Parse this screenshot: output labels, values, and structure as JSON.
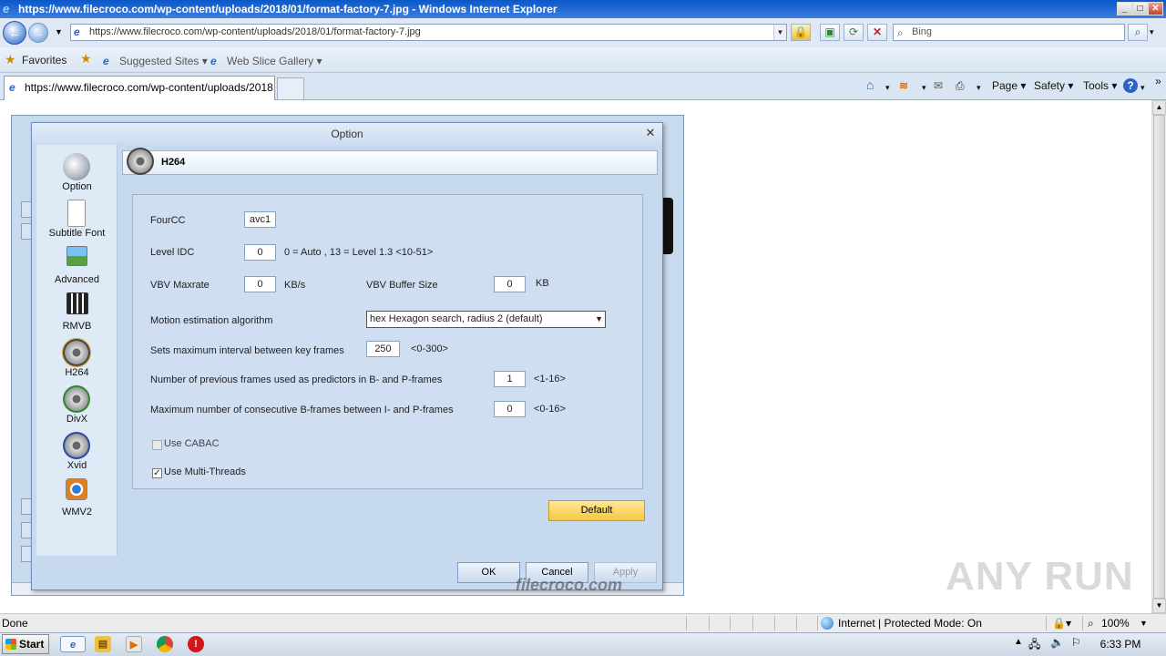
{
  "browser": {
    "window_title": "https://www.filecroco.com/wp-content/uploads/2018/01/format-factory-7.jpg - Windows Internet Explorer",
    "address_url": "https://www.filecroco.com/wp-content/uploads/2018/01/format-factory-7.jpg",
    "search_placeholder": "Bing",
    "favorites_label": "Favorites",
    "suggested_sites": "Suggested Sites",
    "web_slice_gallery": "Web Slice Gallery",
    "tab_title": "https://www.filecroco.com/wp-content/uploads/2018...",
    "commands": {
      "page": "Page",
      "safety": "Safety",
      "tools": "Tools"
    },
    "status_text": "Done",
    "zone_text": "Internet | Protected Mode: On",
    "zoom": "100%"
  },
  "dialog": {
    "title": "Option",
    "section_title": "H264",
    "nav_items": [
      {
        "label": "Option"
      },
      {
        "label": "Subtitle Font"
      },
      {
        "label": "Advanced"
      },
      {
        "label": "RMVB"
      },
      {
        "label": "H264"
      },
      {
        "label": "DivX"
      },
      {
        "label": "Xvid"
      },
      {
        "label": "WMV2"
      }
    ],
    "selected_nav": "H264",
    "fields": {
      "fourcc_label": "FourCC",
      "fourcc_value": "avc1",
      "level_idc_label": "Level IDC",
      "level_idc_value": "0",
      "level_idc_hint": "0 = Auto , 13 = Level 1.3 <10-51>",
      "vbv_maxrate_label": "VBV Maxrate",
      "vbv_maxrate_value": "0",
      "vbv_maxrate_unit": "KB/s",
      "vbv_buffer_label": "VBV Buffer Size",
      "vbv_buffer_value": "0",
      "vbv_buffer_unit": "KB",
      "motion_label": "Motion estimation algorithm",
      "motion_value": "hex  Hexagon search, radius 2 (default)",
      "keyframe_label": "Sets maximum interval between key frames",
      "keyframe_value": "250",
      "keyframe_hint": "<0-300>",
      "prev_frames_label": "Number of previous frames used as predictors in B- and P-frames",
      "prev_frames_value": "1",
      "prev_frames_hint": "<1-16>",
      "bframes_label": "Maximum number of consecutive B-frames between I- and P-frames",
      "bframes_value": "0",
      "bframes_hint": "<0-16>",
      "cabac_label": "Use CABAC",
      "cabac_checked": false,
      "multithreads_label": "Use Multi-Threads",
      "multithreads_checked": true
    },
    "buttons": {
      "default": "Default",
      "ok": "OK",
      "cancel": "Cancel",
      "apply": "Apply"
    }
  },
  "taskbar": {
    "start_label": "Start",
    "clock": "6:33 PM"
  },
  "watermarks": {
    "anyrun": "ANY RUN",
    "filecroco": "filecroco.com"
  }
}
